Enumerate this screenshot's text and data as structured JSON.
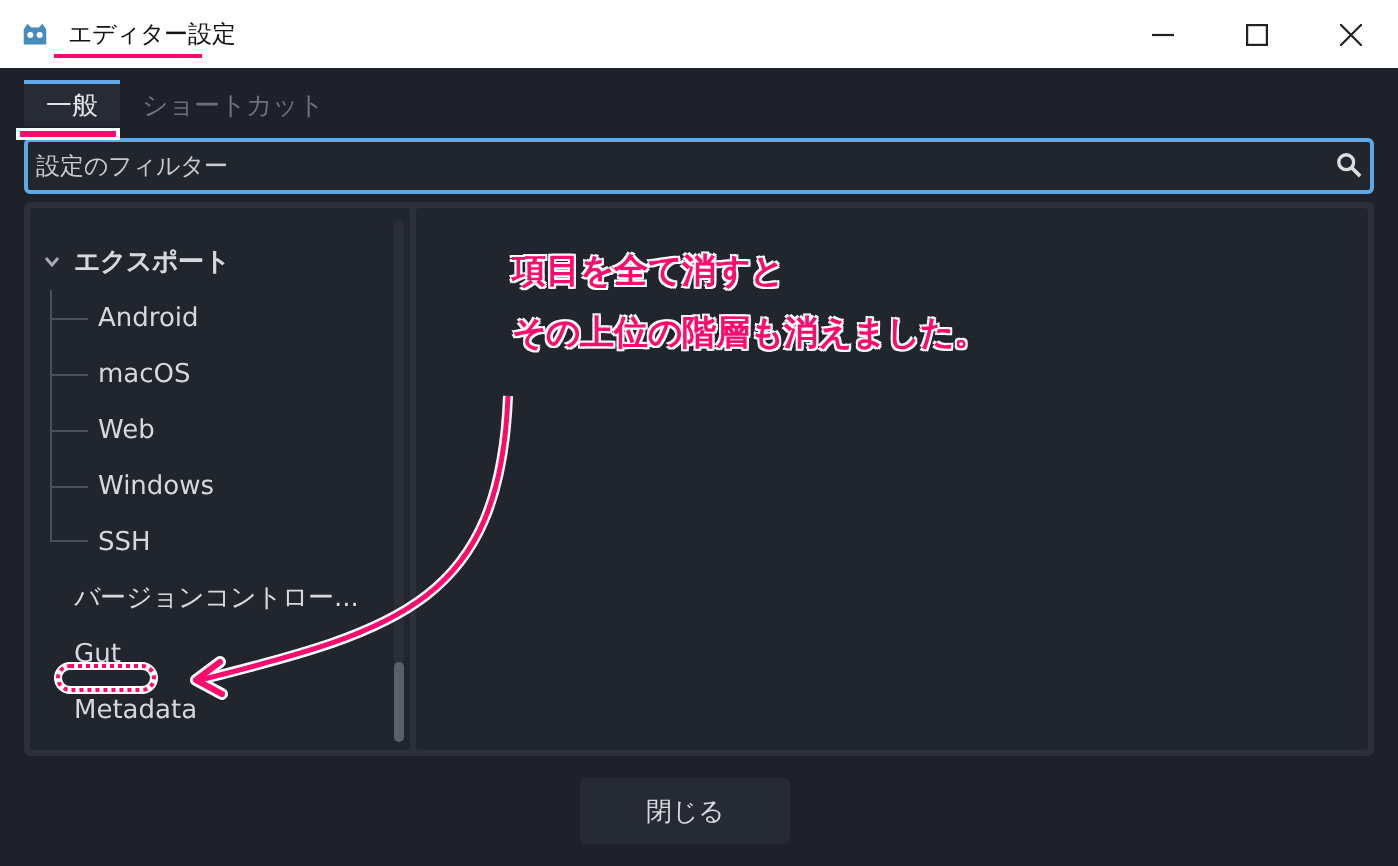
{
  "window": {
    "title": "エディター設定"
  },
  "tabs": [
    {
      "label": "一般",
      "selected": true
    },
    {
      "label": "ショートカット",
      "selected": false
    }
  ],
  "filter": {
    "placeholder": "設定のフィルター"
  },
  "tree": [
    {
      "label": "エクスポート",
      "expanded": true,
      "children": [
        {
          "label": "Android"
        },
        {
          "label": "macOS"
        },
        {
          "label": "Web"
        },
        {
          "label": "Windows"
        },
        {
          "label": "SSH"
        }
      ]
    },
    {
      "label": "バージョンコントロー..."
    },
    {
      "label": "Gut"
    },
    {
      "label": "Metadata"
    }
  ],
  "annotation": {
    "lines": [
      "項目を全て消すと",
      "その上位の階層も消えました。"
    ]
  },
  "buttons": [
    "閉じる"
  ]
}
